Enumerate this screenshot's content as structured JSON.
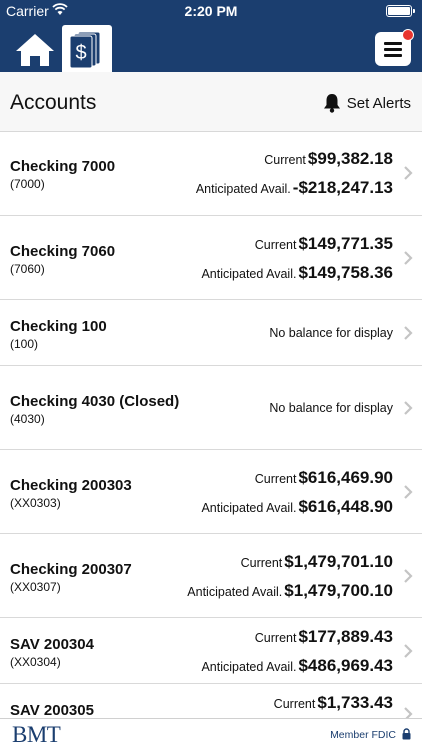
{
  "status_bar": {
    "carrier": "Carrier",
    "time": "2:20 PM"
  },
  "nav": {
    "icons": [
      "home-icon",
      "accounts-icon",
      "menu-icon"
    ],
    "accent": "#1b3e6f",
    "alert_dot_color": "#e8352f"
  },
  "page": {
    "title": "Accounts",
    "set_alerts_label": "Set Alerts"
  },
  "accounts": [
    {
      "name": "Checking 7000",
      "number": "(7000)",
      "current_label": "Current",
      "current": "$99,382.18",
      "anticipated_label": "Anticipated Avail.",
      "anticipated": "-$218,247.13"
    },
    {
      "name": "Checking 7060",
      "number": "(7060)",
      "current_label": "Current",
      "current": "$149,771.35",
      "anticipated_label": "Anticipated Avail.",
      "anticipated": "$149,758.36"
    },
    {
      "name": "Checking 100",
      "number": "(100)",
      "no_balance": "No balance for display"
    },
    {
      "name": "Checking 4030 (Closed)",
      "number": "(4030)",
      "no_balance": "No balance for display"
    },
    {
      "name": "Checking 200303",
      "number": "(XX0303)",
      "current_label": "Current",
      "current": "$616,469.90",
      "anticipated_label": "Anticipated Avail.",
      "anticipated": "$616,448.90"
    },
    {
      "name": "Checking 200307",
      "number": "(XX0307)",
      "current_label": "Current",
      "current": "$1,479,701.10",
      "anticipated_label": "Anticipated Avail.",
      "anticipated": "$1,479,700.10"
    },
    {
      "name": "SAV 200304",
      "number": "(XX0304)",
      "current_label": "Current",
      "current": "$177,889.43",
      "anticipated_label": "Anticipated Avail.",
      "anticipated": "$486,969.43"
    },
    {
      "name": "SAV 200305",
      "current_label": "Current",
      "current": "$1,733.43"
    }
  ],
  "footer": {
    "logo": "BMT",
    "fdic": "Member FDIC"
  }
}
